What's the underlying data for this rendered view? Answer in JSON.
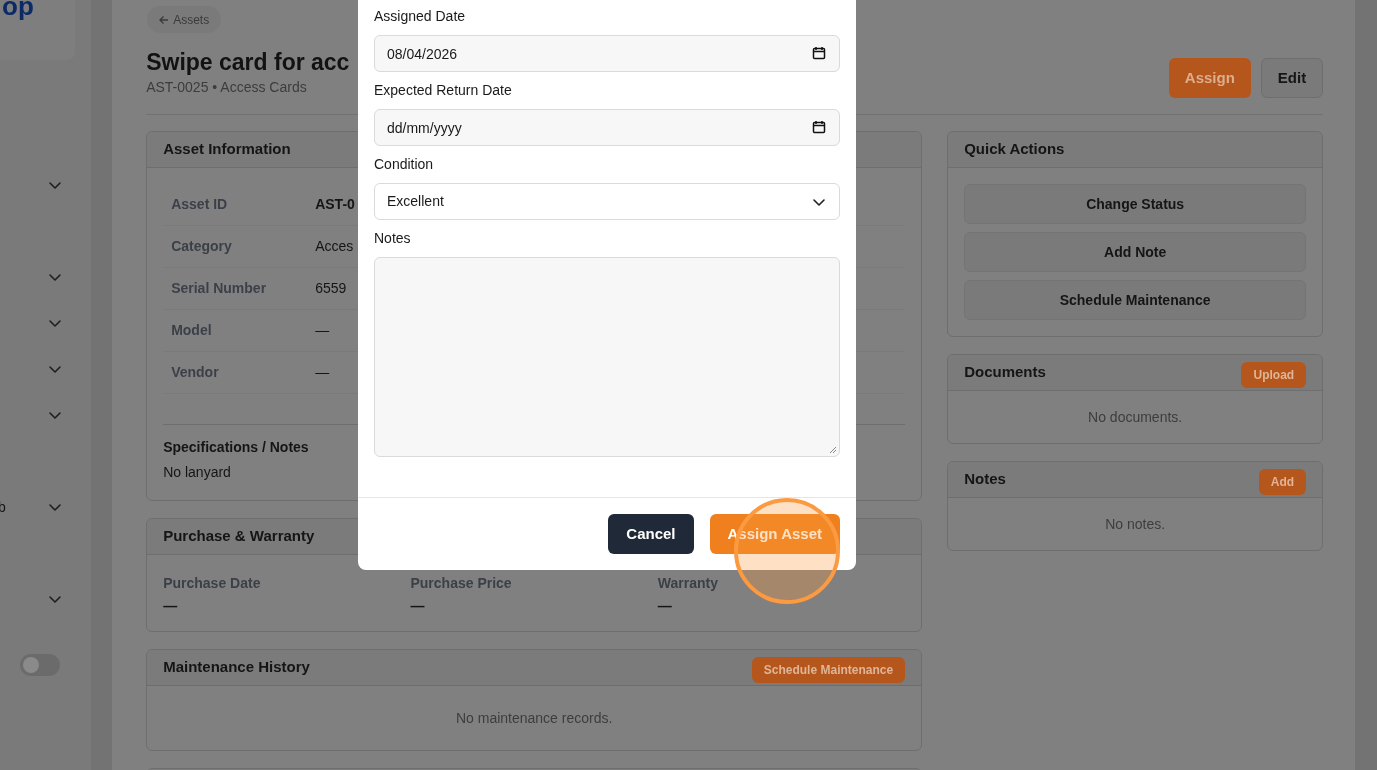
{
  "sidebar": {
    "logo": "op",
    "items": [
      {
        "kind": "group",
        "expanded": false
      },
      {
        "kind": "link"
      },
      {
        "kind": "group",
        "expanded": false
      },
      {
        "kind": "group",
        "expanded": false
      },
      {
        "kind": "group",
        "expanded": false
      },
      {
        "kind": "group",
        "expanded": false
      },
      {
        "kind": "link"
      },
      {
        "kind": "group",
        "label": "b",
        "expanded": false
      },
      {
        "kind": "link"
      },
      {
        "kind": "group",
        "expanded": false
      }
    ],
    "toggle": {
      "on": false
    }
  },
  "breadcrumb": "Assets",
  "title": "Swipe card for acc",
  "subtitle": "AST-0025 • Access Cards",
  "header_buttons": [
    {
      "label": "Assign",
      "kind": "primary"
    },
    {
      "label": "Edit",
      "kind": "secondary"
    }
  ],
  "asset_information": {
    "title": "Asset Information",
    "rows": [
      {
        "label": "Asset ID",
        "value": "AST-0",
        "bold": true
      },
      {
        "label": "Category",
        "value": "Acces",
        "bold": false
      },
      {
        "label": "Serial Number",
        "value": "6559",
        "bold": false
      },
      {
        "label": "Model",
        "value": "—",
        "bold": false
      },
      {
        "label": "Vendor",
        "value": "—",
        "bold": false
      }
    ],
    "specs_title": "Specifications / Notes",
    "specs": "No lanyard"
  },
  "purchase_warranty": {
    "title": "Purchase & Warranty",
    "fields": [
      {
        "label": "Purchase Date",
        "value": "—"
      },
      {
        "label": "Purchase Price",
        "value": "—"
      },
      {
        "label": "Warranty",
        "value": "—"
      }
    ]
  },
  "maintenance": {
    "title": "Maintenance History",
    "button": "Schedule Maintenance",
    "empty": "No maintenance records."
  },
  "quick_actions": {
    "title": "Quick Actions",
    "buttons": [
      "Change Status",
      "Add Note",
      "Schedule Maintenance"
    ]
  },
  "documents": {
    "title": "Documents",
    "button": "Upload",
    "empty": "No documents."
  },
  "notes": {
    "title": "Notes",
    "button": "Add",
    "empty": "No notes."
  },
  "modal": {
    "fields": [
      {
        "kind": "date",
        "label": "Assigned Date",
        "value": "08/04/2026"
      },
      {
        "kind": "date",
        "label": "Expected Return Date",
        "placeholder": "dd/mm/yyyy"
      },
      {
        "kind": "select",
        "label": "Condition",
        "value": "Excellent"
      },
      {
        "kind": "textarea",
        "label": "Notes"
      }
    ],
    "buttons": [
      {
        "label": "Cancel",
        "kind": "cancel"
      },
      {
        "label": "Assign Asset",
        "kind": "confirm"
      }
    ]
  }
}
